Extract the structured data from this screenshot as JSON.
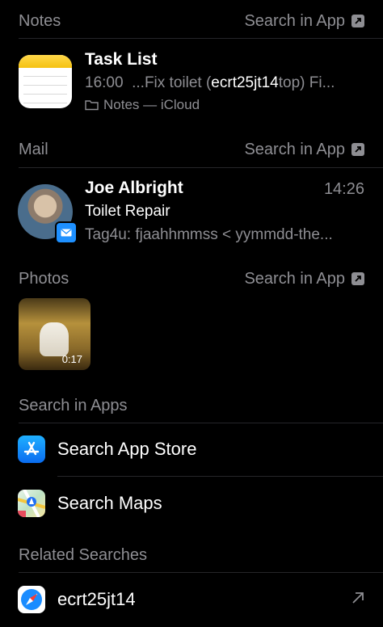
{
  "notes": {
    "header": "Notes",
    "search_in_app": "Search in App",
    "result": {
      "title": "Task List",
      "time": "16:00",
      "snippet_pre": "...Fix toilet (",
      "snippet_match": "ecrt25jt14",
      "snippet_post": "top) Fi...",
      "location": "Notes — iCloud"
    }
  },
  "mail": {
    "header": "Mail",
    "search_in_app": "Search in App",
    "result": {
      "sender": "Joe Albright",
      "time": "14:26",
      "subject": "Toilet Repair",
      "preview": "Tag4u: fjaahhmmss < yymmdd-the..."
    }
  },
  "photos": {
    "header": "Photos",
    "search_in_app": "Search in App",
    "video_duration": "0:17"
  },
  "search_in_apps": {
    "header": "Search in Apps",
    "items": [
      {
        "label": "Search App Store",
        "icon": "app-store-icon"
      },
      {
        "label": "Search Maps",
        "icon": "maps-icon"
      }
    ]
  },
  "related": {
    "header": "Related Searches",
    "items": [
      {
        "label": "ecrt25jt14",
        "icon": "safari-icon"
      }
    ]
  },
  "colors": {
    "background": "#000000",
    "secondary_text": "#8e8e93",
    "separator": "#262629"
  }
}
